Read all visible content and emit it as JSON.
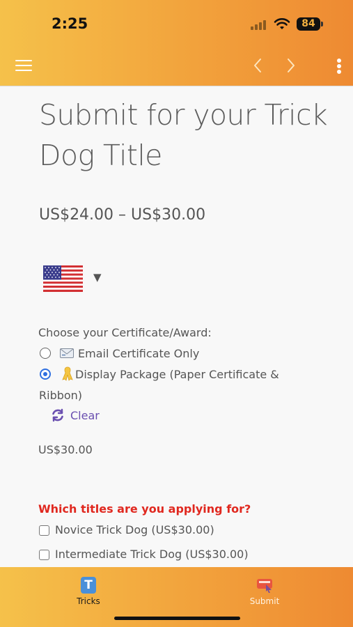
{
  "status": {
    "time": "2:25",
    "battery": "84"
  },
  "page": {
    "title": "Submit for your Trick Dog Title",
    "price_range": "US$24.00 – US$30.00"
  },
  "certificate": {
    "label": "Choose your Certificate/Award:",
    "options": [
      {
        "text": "Email Certificate Only",
        "icon": "envelope-icon",
        "checked": false
      },
      {
        "text": "Display Package (Paper Certificate & Ribbon)",
        "icon": "ribbon-icon",
        "checked": true
      }
    ],
    "clear_label": "Clear",
    "selected_price": "US$30.00"
  },
  "titles": {
    "heading": "Which titles are you applying for?",
    "options": [
      {
        "text": "Novice Trick Dog (US$30.00)",
        "checked": false
      },
      {
        "text": "Intermediate Trick Dog (US$30.00)",
        "checked": false
      }
    ]
  },
  "tabbar": {
    "tabs": [
      {
        "label": "Tricks",
        "icon": "tricks-icon",
        "active": true
      },
      {
        "label": "Submit",
        "icon": "submit-icon",
        "active": false
      }
    ]
  },
  "colors": {
    "header_gradient_start": "#f5c14a",
    "header_gradient_end": "#ee8a32",
    "accent_purple": "#6a4fb0",
    "heading_red": "#e0281f",
    "radio_blue": "#2f6fe0"
  }
}
